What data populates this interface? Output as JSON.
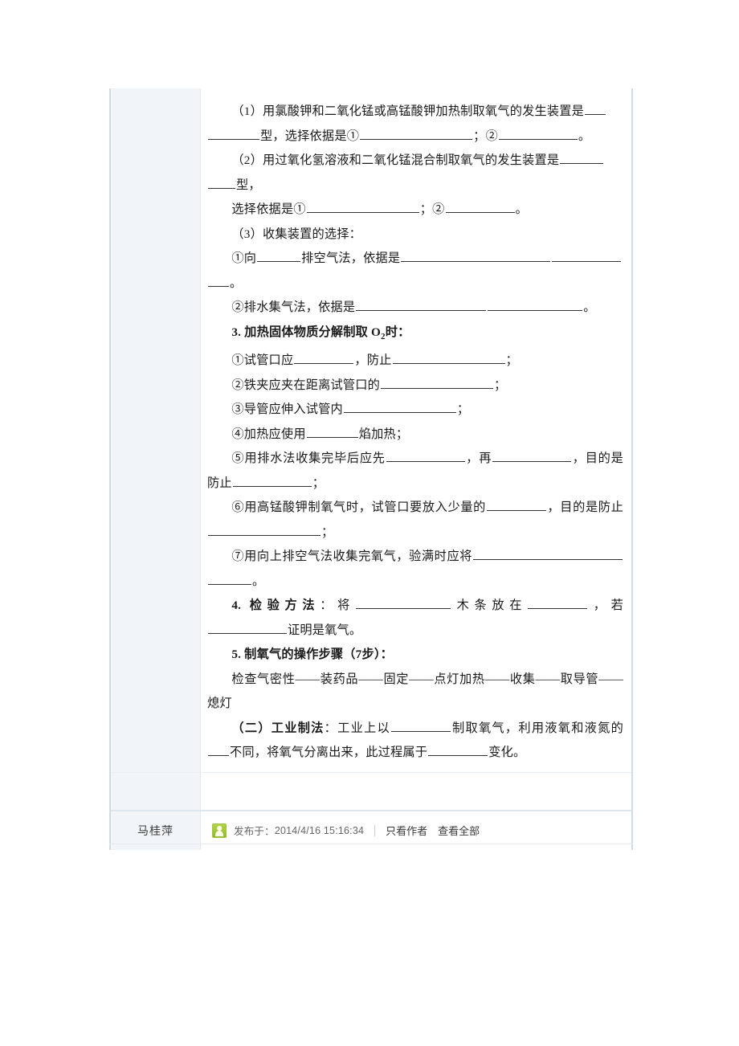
{
  "post": {
    "author": "马桂萍",
    "avatar_icon": "user-avatar-icon",
    "published_prefix": "发布于：",
    "timestamp": "2014/4/16 15:16:34",
    "links": {
      "author_only": "只看作者",
      "view_all": "查看全部"
    }
  },
  "colors": {
    "border": "#cfdce6",
    "gutter_bg": "#f2f5f8",
    "avatar_green": "#8fbb26",
    "text": "#1a1a1a"
  },
  "content": {
    "p1_a": "（1）用氯酸钾和二氧化锰或高锰酸钾加热制取氧气的发生装置是",
    "p1_b": "型，选择依据是①",
    "p1_c": "；②",
    "p1_d": "。",
    "p2_a": "（2）用过氧化氢溶液和二氧化锰混合制取氧气的发生装置是",
    "p2_b": "型，",
    "p3_a": "选择依据是①",
    "p3_b": "；②",
    "p3_c": "。",
    "p4": "（3）收集装置的选择：",
    "p5_a": "①向",
    "p5_b": "排空气法，依据是",
    "p5_c": "。",
    "p6_a": "②排水集气法，依据是",
    "p6_b": "。",
    "h3": "3. 加热固体物质分解制取 O",
    "h3_sub": "2",
    "h3_tail": "时：",
    "p7_a": "①试管口应",
    "p7_b": "，防止",
    "p7_c": "；",
    "p8_a": "②铁夹应夹在距离试管口的",
    "p8_b": "；",
    "p9_a": "③导管应伸入试管内",
    "p9_b": "；",
    "p10_a": "④加热应使用",
    "p10_b": "焰加热；",
    "p11_a": "⑤用排水法收集完毕后应先",
    "p11_b": "，再",
    "p11_c": "，目的是防止",
    "p11_d": "；",
    "p12_a": "⑥用高锰酸钾制氧气时，试管口要放入少量的",
    "p12_b": "，目的是防止",
    "p12_c": "；",
    "p13_a": "⑦用向上排空气法收集完氧气，验满时应将",
    "p13_b": "。",
    "h4": "4. 检验方法",
    "p14_a": "：将",
    "p14_b": "木条放在",
    "p14_c": "，若",
    "p14_d": "证明是氧气。",
    "h5": "5. 制氧气的操作步骤（7步）：",
    "p15": "检查气密性——装药品——固定——点灯加热——收集——取导管——熄灯",
    "h6_a": "（二）",
    "h6_b": "工业制法",
    "p16_a": "：工业上以",
    "p16_b": "制取氧气，利用液氧和液氮的",
    "p16_c": "不同，将氧气分离出来，此过程属于",
    "p16_d": "变化。"
  }
}
